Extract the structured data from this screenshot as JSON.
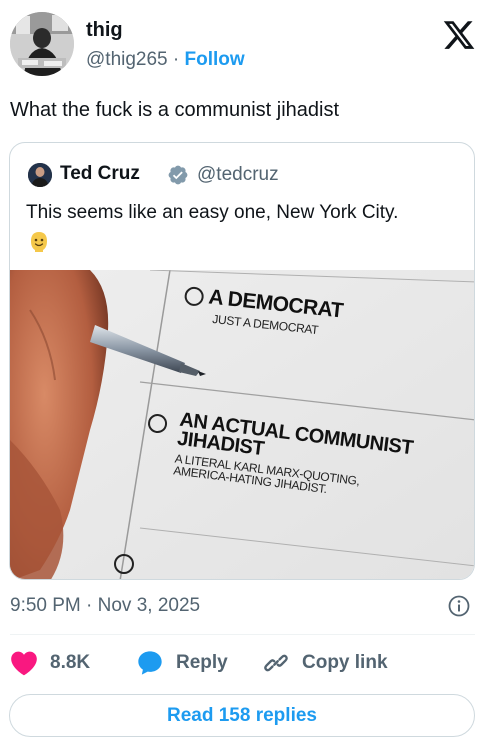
{
  "author": {
    "display_name": "thig",
    "handle": "@thig265",
    "separator": " · ",
    "follow_label": "Follow"
  },
  "tweet": {
    "text": "What the fuck is a communist jihadist",
    "timestamp": "9:50 PM · Nov 3, 2025"
  },
  "quoted": {
    "display_name": "Ted Cruz",
    "handle": "@tedcruz",
    "text": "This seems like an easy one, New York City.",
    "emoji": "smiling-face-emoji",
    "ballot": {
      "option1_title": "A DEMOCRAT",
      "option1_sub": "JUST A DEMOCRAT",
      "option2_title_line1": "AN ACTUAL COMMUNIST",
      "option2_title_line2": "JIHADIST",
      "option2_sub_line1": "A LITERAL KARL MARX-QUOTING,",
      "option2_sub_line2": "AMERICA-HATING JIHADIST."
    }
  },
  "actions": {
    "like_count": "8.8K",
    "reply_label": "Reply",
    "copy_link_label": "Copy link",
    "read_replies_label": "Read 158 replies"
  },
  "icons": {
    "brand": "x-logo-icon",
    "verified": "verified-badge-icon",
    "info": "info-icon",
    "like": "heart-icon",
    "reply": "speech-bubble-icon",
    "copy_link": "link-icon"
  },
  "colors": {
    "accent": "#1d9bf0",
    "like": "#f91880",
    "text_primary": "#0f1419",
    "text_secondary": "#536471",
    "border": "#cfd9de"
  }
}
